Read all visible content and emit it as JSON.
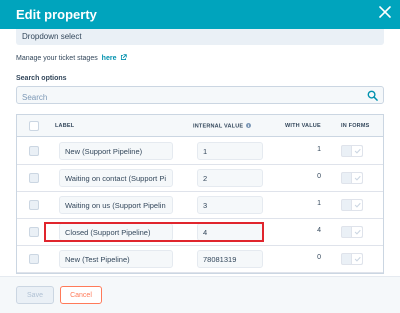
{
  "dialog": {
    "title": "Edit property"
  },
  "field_type": {
    "value": "Dropdown select"
  },
  "manage_link": {
    "prefix": "Manage your ticket stages",
    "link_text": "here"
  },
  "search": {
    "label": "Search options",
    "placeholder": "Search"
  },
  "table": {
    "headers": {
      "label": "LABEL",
      "internal_value": "INTERNAL VALUE",
      "with_value": "WITH VALUE",
      "in_forms": "IN FORMS"
    },
    "rows": [
      {
        "label": "New (Support Pipeline)",
        "internal_value": "1",
        "with_value": "1",
        "in_forms": true
      },
      {
        "label": "Waiting on contact (Support Pi",
        "internal_value": "2",
        "with_value": "0",
        "in_forms": true
      },
      {
        "label": "Waiting on us (Support Pipelin",
        "internal_value": "3",
        "with_value": "1",
        "in_forms": true
      },
      {
        "label": "Closed (Support Pipeline)",
        "internal_value": "4",
        "with_value": "4",
        "in_forms": true
      },
      {
        "label": "New (Test Pipeline)",
        "internal_value": "78081319",
        "with_value": "0",
        "in_forms": true
      }
    ]
  },
  "footer": {
    "save_label": "Save",
    "cancel_label": "Cancel"
  },
  "colors": {
    "header_bg": "#00a4bd",
    "highlight": "#e0252d",
    "cancel_accent": "#ff7a59"
  }
}
